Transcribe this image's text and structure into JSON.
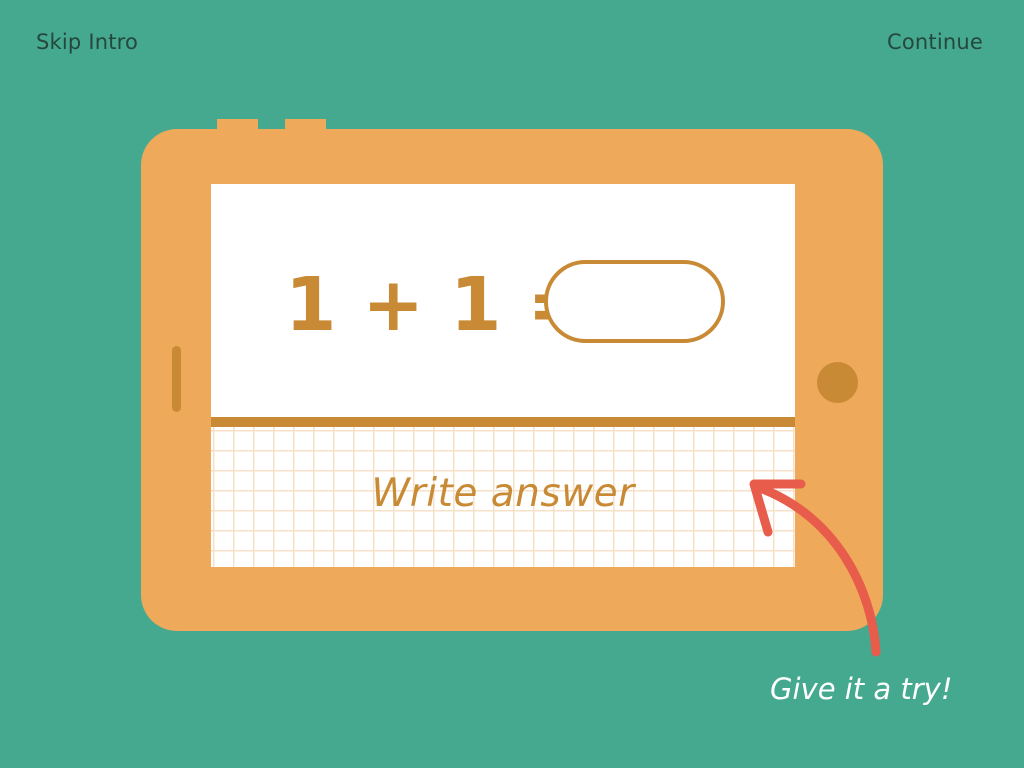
{
  "nav": {
    "skip_label": "Skip Intro",
    "continue_label": "Continue"
  },
  "equation": {
    "text": "1 + 1 ="
  },
  "answer": {
    "value": ""
  },
  "writing_pad": {
    "hint": "Write answer"
  },
  "callout": {
    "text": "Give it a try!"
  },
  "colors": {
    "background": "#45a98f",
    "tablet": "#eea95a",
    "accent": "#c98a35",
    "arrow": "#e85c4b",
    "grid": "#f7e0c8"
  }
}
